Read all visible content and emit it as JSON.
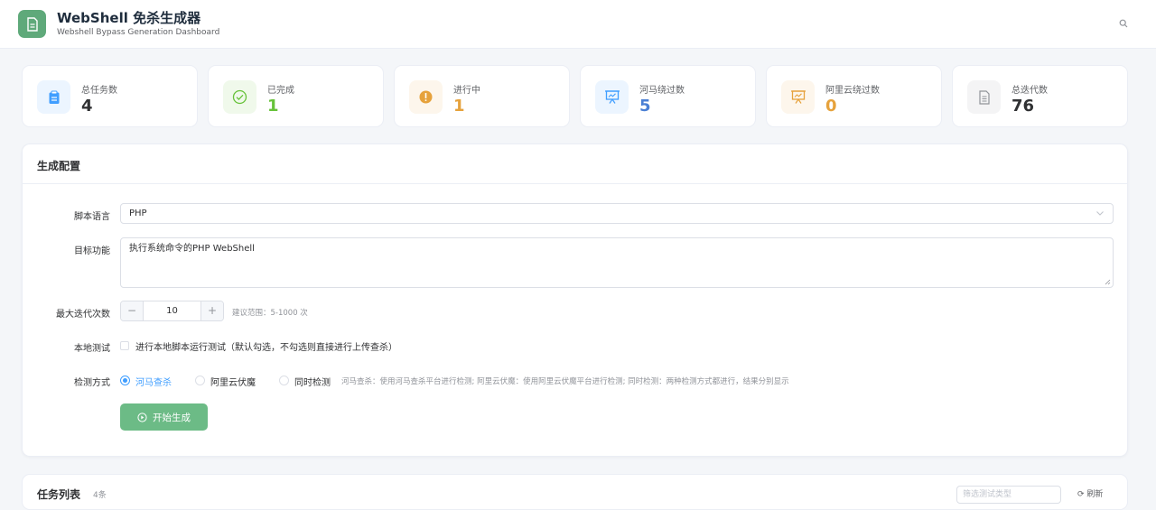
{
  "header": {
    "title": "WebShell 免杀生成器",
    "subtitle": "Webshell Bypass Generation Dashboard",
    "logo_icon": "document-icon",
    "search_icon": "search-icon"
  },
  "stats": [
    {
      "label": "总任务数",
      "value": "4",
      "icon": "clipboard-icon",
      "color": "#409eff",
      "bg": "#ecf5ff"
    },
    {
      "label": "已完成",
      "value": "1",
      "icon": "check-circle-icon",
      "color": "#67c23a",
      "bg": "#f0f9eb"
    },
    {
      "label": "进行中",
      "value": "1",
      "icon": "warning-circle-icon",
      "color": "#e6a23c",
      "bg": "#fdf6ec"
    },
    {
      "label": "河马绕过数",
      "value": "5",
      "icon": "presentation-icon",
      "color": "#409eff",
      "bg": "#ecf5ff"
    },
    {
      "label": "阿里云绕过数",
      "value": "0",
      "icon": "presentation-icon",
      "color": "#e6a23c",
      "bg": "#fdf6ec"
    },
    {
      "label": "总迭代数",
      "value": "76",
      "icon": "document-icon",
      "color": "#303133",
      "bg": "#f4f4f5"
    }
  ],
  "config": {
    "title": "生成配置",
    "language_label": "脚本语言",
    "language_value": "PHP",
    "function_label": "目标功能",
    "function_value": "执行系统命令的PHP WebShell",
    "iterations_label": "最大迭代次数",
    "iterations_value": "10",
    "iterations_minus": "−",
    "iterations_plus": "+",
    "iterations_hint": "建议范围：5-1000 次",
    "local_test_label": "本地测试",
    "local_test_text": "进行本地脚本运行测试（默认勾选，不勾选则直接进行上传查杀）",
    "detect_label": "检测方式",
    "detect_options": [
      "河马查杀",
      "阿里云伏魔",
      "同时检测"
    ],
    "detect_selected": "河马查杀",
    "detect_hint": "河马查杀：使用河马查杀平台进行检测; 阿里云伏魔：使用阿里云伏魔平台进行检测; 同时检测：两种检测方式都进行，结果分别显示",
    "start_button": "开始生成"
  },
  "tasklist": {
    "title": "任务列表",
    "count": "4条",
    "filter_placeholder": "筛选测试类型",
    "refresh": "刷新"
  }
}
